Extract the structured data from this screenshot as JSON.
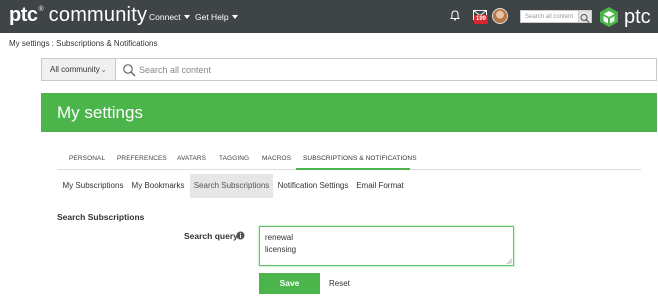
{
  "topbar": {
    "brand": {
      "ptc": "ptc",
      "reg": "®",
      "community": "community"
    },
    "nav": [
      {
        "label": "Connect"
      },
      {
        "label": "Get Help"
      }
    ],
    "mail_badge": "199",
    "search_placeholder": "Search all content",
    "logo_text": "ptc",
    "background": "#3f4447"
  },
  "breadcrumb": "My settings : Subscriptions & Notifications",
  "community_search": {
    "scope": "All community",
    "placeholder": "Search all content"
  },
  "header": {
    "title": "My settings",
    "color": "#4bb44a"
  },
  "primary_tabs": [
    {
      "label": "PERSONAL"
    },
    {
      "label": "PREFERENCES"
    },
    {
      "label": "AVATARS"
    },
    {
      "label": "TAGGING"
    },
    {
      "label": "MACROS"
    },
    {
      "label": "SUBSCRIPTIONS & NOTIFICATIONS",
      "active": true
    }
  ],
  "secondary_tabs": [
    {
      "label": "My Subscriptions"
    },
    {
      "label": "My Bookmarks"
    },
    {
      "label": "Search Subscriptions",
      "active": true
    },
    {
      "label": "Notification Settings"
    },
    {
      "label": "Email Format"
    }
  ],
  "form": {
    "section_title": "Search Subscriptions",
    "field_label": "Search query",
    "query_lines": [
      "renewal",
      "licensing"
    ],
    "save_label": "Save",
    "reset_label": "Reset"
  }
}
